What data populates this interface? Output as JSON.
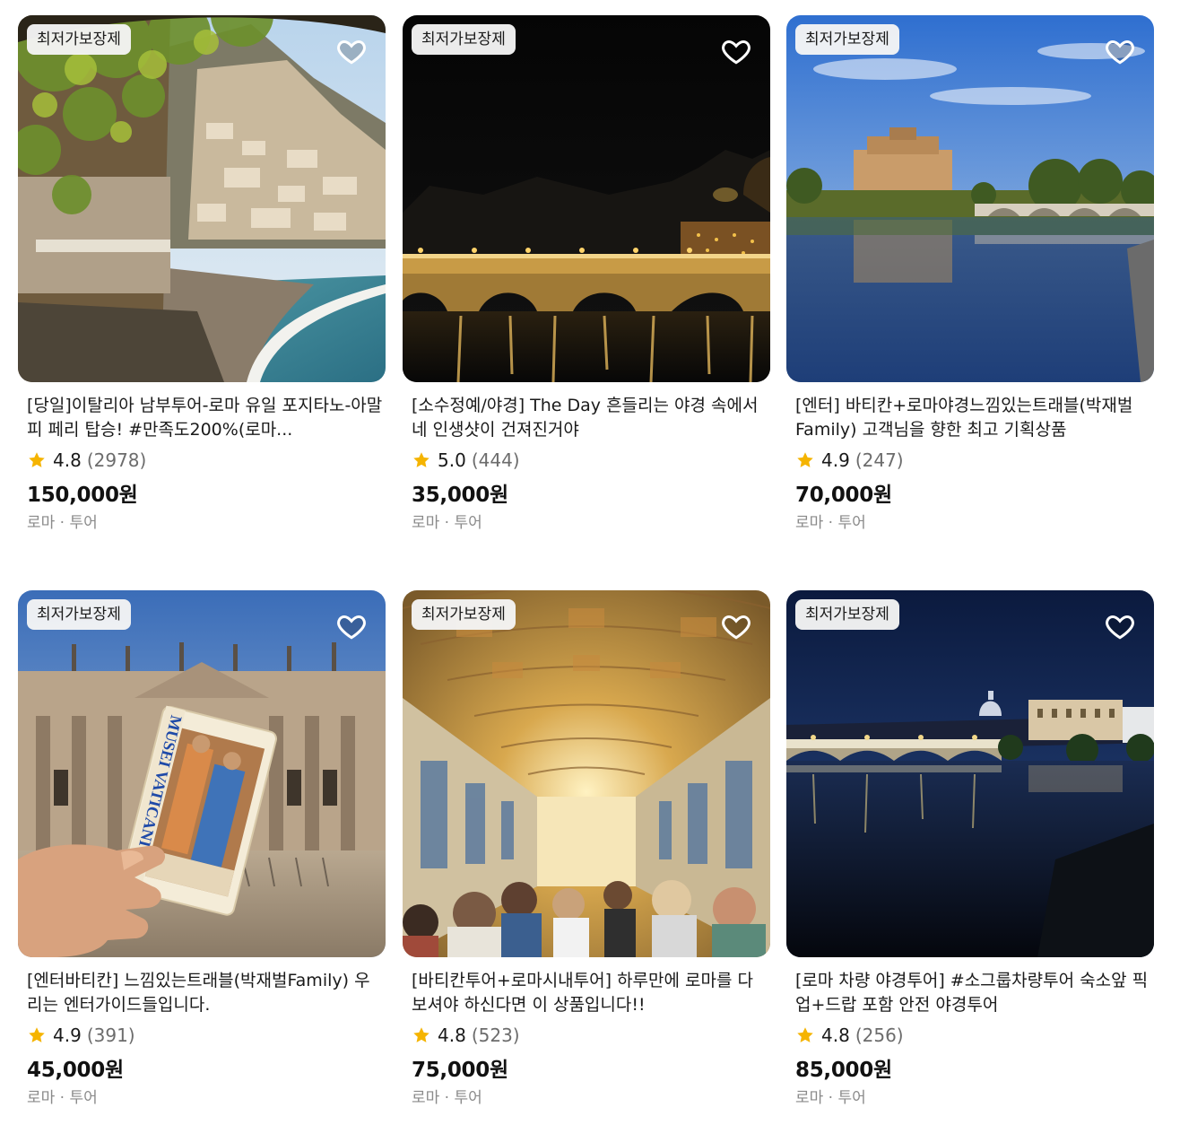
{
  "products": [
    {
      "badge": "최저가보장제",
      "title": "[당일]이탈리아 남부투어-로마 유일 포지타노-아말피 페리 탑승! #만족도200%(로마...",
      "score": "4.8",
      "reviews": "(2978)",
      "price": "150,000원",
      "meta": "로마 · 투어",
      "image": "positano-coast-scene"
    },
    {
      "badge": "최저가보장제",
      "title": "[소수정예/야경] The Day 흔들리는 야경 속에서 네 인생샷이 건져진거야",
      "score": "5.0",
      "reviews": "(444)",
      "price": "35,000원",
      "meta": "로마 · 투어",
      "image": "rome-bridge-night-scene"
    },
    {
      "badge": "최저가보장제",
      "title": "[엔터] 바티칸+로마야경느낌있는트래블(박재벌Family) 고객님을 향한 최고 기획상품",
      "score": "4.9",
      "reviews": "(247)",
      "price": "70,000원",
      "meta": "로마 · 투어",
      "image": "castel-sant-angelo-scene"
    },
    {
      "badge": "최저가보장제",
      "title": "[엔터바티칸] 느낌있는트래블(박재벌Family) 우리는 엔터가이드들입니다.",
      "score": "4.9",
      "reviews": "(391)",
      "price": "45,000원",
      "meta": "로마 · 투어",
      "image": "musei-vaticani-ticket-scene",
      "ticket_text": "MUSEI VATICANI"
    },
    {
      "badge": "최저가보장제",
      "title": "[바티칸투어+로마시내투어] 하루만에 로마를 다 보셔야 하신다면 이 상품입니다!!",
      "score": "4.8",
      "reviews": "(523)",
      "price": "75,000원",
      "meta": "로마 · 투어",
      "image": "gallery-of-maps-scene"
    },
    {
      "badge": "최저가보장제",
      "title": "[로마 차량 야경투어] #소그룹차량투어 숙소앞 픽업+드랍 포함 안전 야경투어",
      "score": "4.8",
      "reviews": "(256)",
      "price": "85,000원",
      "meta": "로마 · 투어",
      "image": "tiber-river-night-scene"
    }
  ],
  "colors": {
    "star": "#F5B400",
    "reviews": "#6C6C6C",
    "meta": "#8A8A8A",
    "badge_bg": "#F5F5F5"
  }
}
